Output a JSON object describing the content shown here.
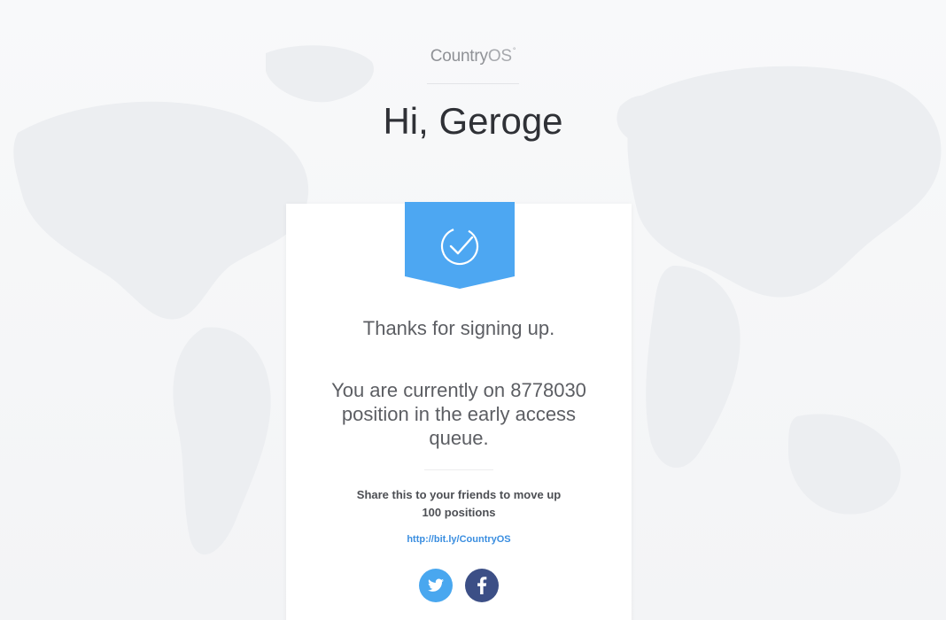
{
  "header": {
    "logo_country": "Country",
    "logo_os": "OS",
    "logo_mark": "°",
    "greeting": "Hi, Geroge"
  },
  "card": {
    "badge_icon": "check-circle-icon",
    "thanks": "Thanks for signing up.",
    "queue_message": "You are currently on 8778030 position in the early access queue.",
    "share_text": "Share this to your friends to move up 100 positions",
    "share_link": "http://bit.ly/CountryOS",
    "social": [
      {
        "name": "twitter",
        "icon": "twitter-icon"
      },
      {
        "name": "facebook",
        "icon": "facebook-icon"
      }
    ]
  },
  "colors": {
    "accent": "#4da7f2",
    "link": "#3a8ee0",
    "twitter": "#49a7ef",
    "facebook": "#3c4f86",
    "background": "#f6f7f9"
  }
}
